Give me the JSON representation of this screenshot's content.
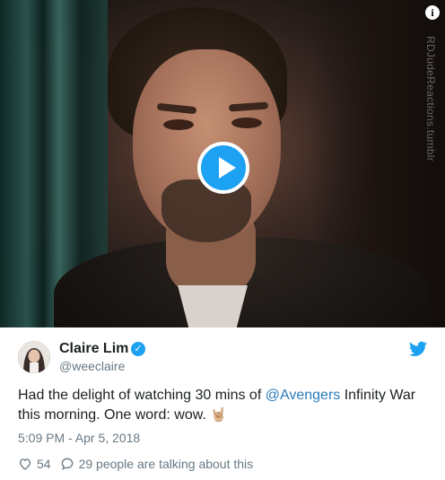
{
  "media": {
    "watermark": "RDJudeReactions.tumblr",
    "info_label": "i"
  },
  "author": {
    "name": "Claire Lim",
    "handle": "@weeclaire",
    "verified": true
  },
  "tweet": {
    "text_before": "Had the delight of watching 30 mins of ",
    "mention": "@Avengers",
    "text_after": " Infinity War this morning. One word: wow. ",
    "emoji": "🤘🏼",
    "timestamp": "5:09 PM - Apr 5, 2018"
  },
  "actions": {
    "likes": "54",
    "talking": "29 people are talking about this"
  },
  "colors": {
    "twitter_blue": "#1da1f2",
    "link_blue": "#2b7bb9",
    "meta_gray": "#697882"
  },
  "icons": {
    "play": "play-icon",
    "info": "info-icon",
    "verified": "verified-badge-icon",
    "bird": "twitter-bird-icon",
    "heart": "heart-icon",
    "comment": "speech-bubble-icon"
  }
}
